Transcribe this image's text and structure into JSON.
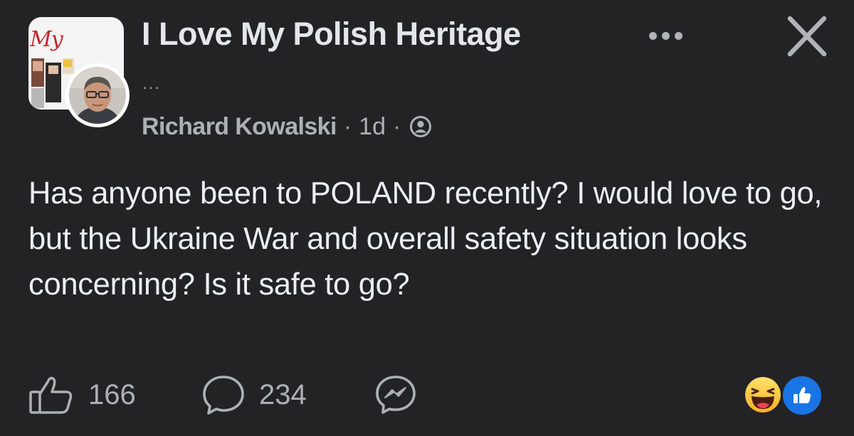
{
  "group": {
    "name": "I Love My Polish Heritage",
    "avatar_text": "My"
  },
  "post": {
    "subline": "...",
    "author": "Richard Kowalski",
    "time": "1d",
    "separator": "·",
    "privacy_icon": "group-members-icon",
    "text": "Has anyone been to POLAND recently? I would love to go, but the Ukraine War and overall safety situation looks concerning? Is it safe to go?"
  },
  "actions": {
    "like_count": "166",
    "comment_count": "234",
    "like_icon": "thumbs-up-icon",
    "comment_icon": "comment-bubble-icon",
    "share_icon": "messenger-icon"
  },
  "reactions": [
    "haha",
    "like"
  ],
  "colors": {
    "background": "#232325",
    "text_primary": "#e4e6eb",
    "text_secondary": "#aeb0b5",
    "like_blue": "#1b74e4",
    "brand_red": "#c8262c"
  }
}
